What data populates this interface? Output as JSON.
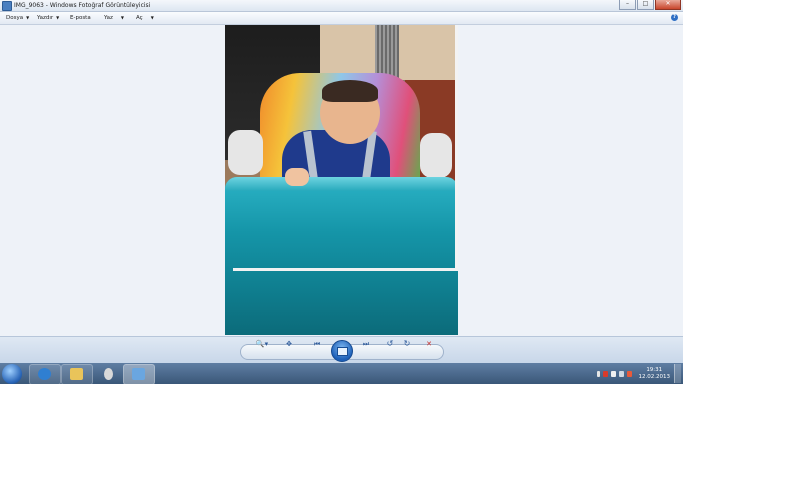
{
  "window": {
    "title": "IMG_9063 - Windows Fotoğraf Görüntüleyicisi",
    "caption_buttons": {
      "minimize": "–",
      "maximize": "□",
      "close": "✕"
    }
  },
  "menubar": {
    "items": [
      {
        "label": "Dosya",
        "arrow": "▼"
      },
      {
        "label": "Yazdır",
        "arrow": "▼"
      },
      {
        "label": "E-posta",
        "arrow": ""
      },
      {
        "label": "Yaz",
        "arrow": "▼"
      },
      {
        "label": "Aç",
        "arrow": "▼"
      }
    ],
    "help": "?"
  },
  "photo": {
    "subject": "baby in high chair",
    "colors": {
      "tray": "#1595a8",
      "bodysuit": "#1f3a8c"
    }
  },
  "controls": {
    "zoom": "🔍▾",
    "fit": "✥",
    "previous": "⏮",
    "slideshow": "▭",
    "next": "⏭",
    "rotate_ccw": "↺",
    "rotate_cw": "↻",
    "delete": "✕"
  },
  "taskbar": {
    "buttons": [
      {
        "name": "internet-explorer",
        "color": "#2f7fd1"
      },
      {
        "name": "file-explorer",
        "color": "#e9c45a"
      },
      {
        "name": "users",
        "color": "#d9d9d9"
      },
      {
        "name": "photo-viewer",
        "color": "#6aa6e0"
      }
    ],
    "tray_icons": [
      "arrow",
      "flag",
      "battery",
      "network",
      "volume"
    ],
    "clock": {
      "time": "19:31",
      "date": "12.02.2013"
    }
  },
  "colors": {
    "accent": "#2d5a9a",
    "background": "#eef2f8",
    "taskbar": "#3a5778",
    "delete": "#c8302a"
  }
}
